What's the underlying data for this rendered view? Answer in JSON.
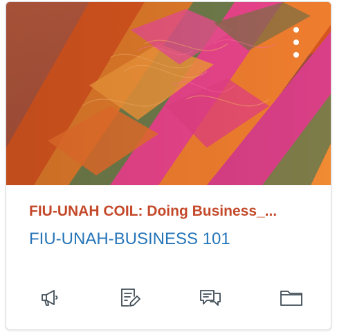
{
  "card": {
    "title": "FIU-UNAH COIL: Doing Business_...",
    "course_code": "FIU-UNAH-BUSINESS 101"
  },
  "colors": {
    "title": "#c4492a",
    "course_code": "#2675b8",
    "icon": "#3f4b55"
  },
  "icons": {
    "options": "more-vertical-icon",
    "announcements": "megaphone-icon",
    "assignments": "assignment-edit-icon",
    "discussions": "discussion-icon",
    "files": "folder-icon"
  }
}
